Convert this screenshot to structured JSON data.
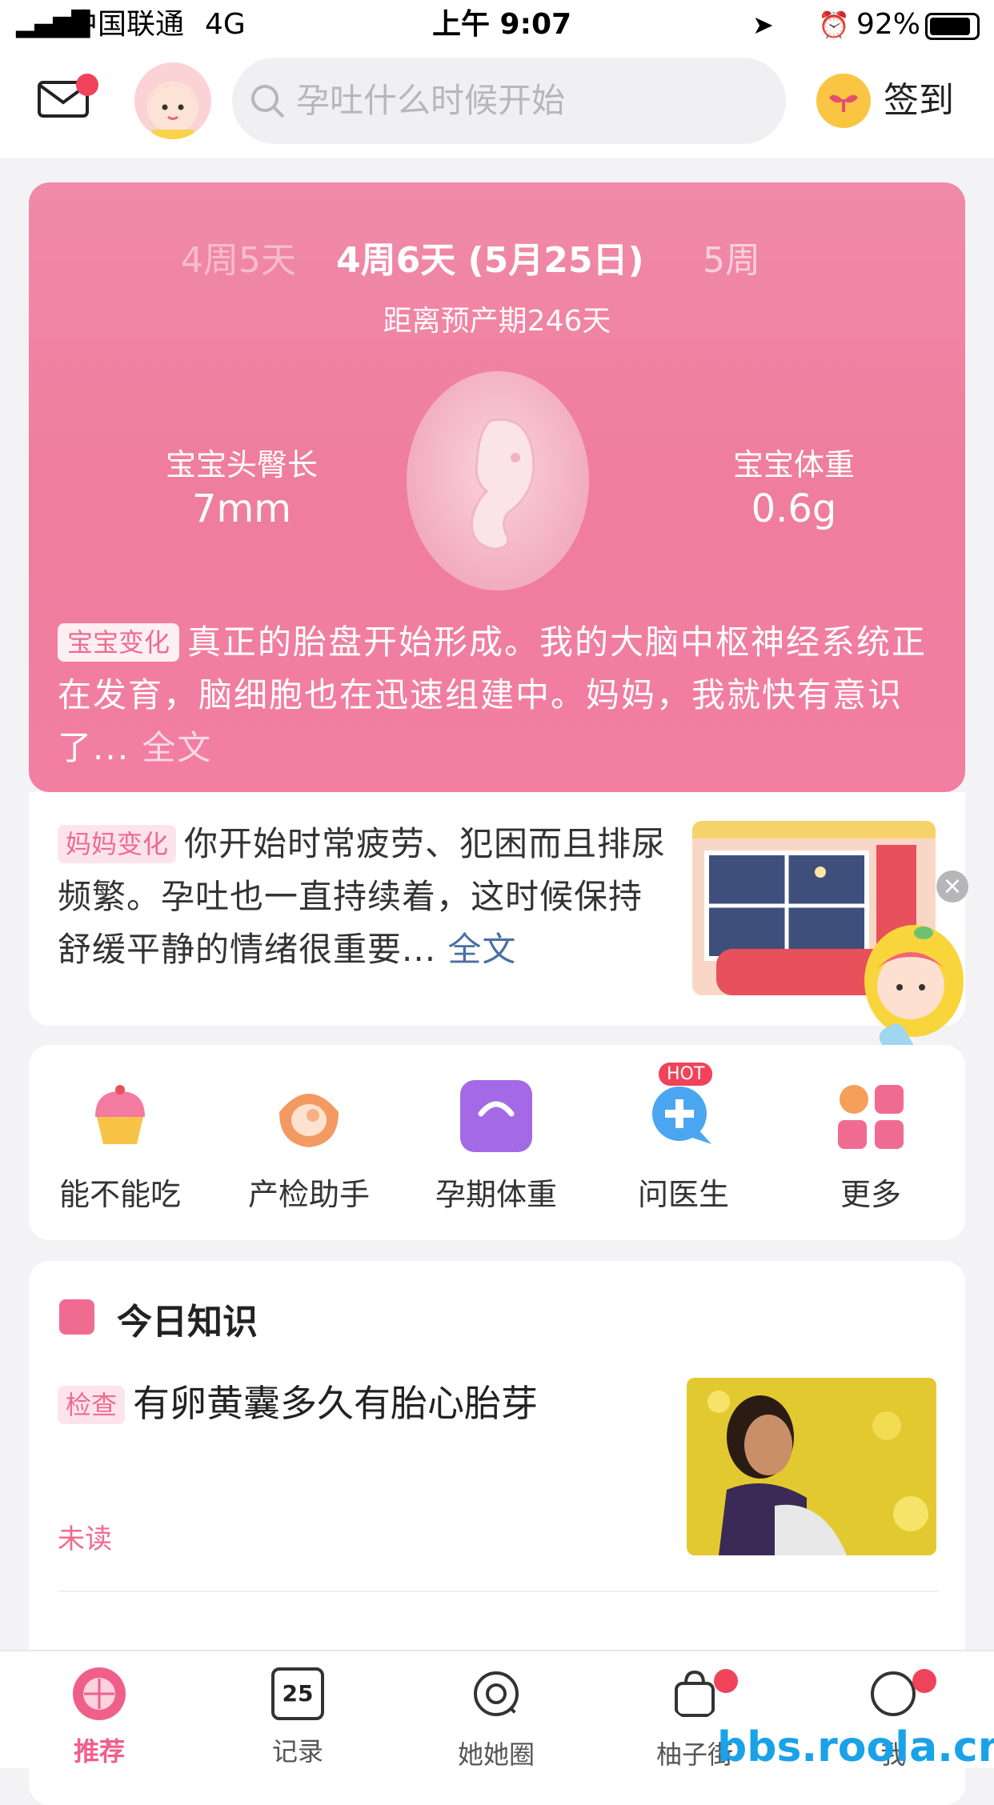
{
  "status": {
    "carrier": "中国联通",
    "network": "4G",
    "time": "上午 9:07",
    "battery": "92%"
  },
  "header": {
    "search_placeholder": "孕吐什么时候开始",
    "sign_in": "签到"
  },
  "pregnancy": {
    "weeks": [
      "4周5天",
      "4周6天 (5月25日)",
      "5周"
    ],
    "countdown": "距离预产期246天",
    "crl_label": "宝宝头臀长",
    "crl_value": "7mm",
    "weight_label": "宝宝体重",
    "weight_value": "0.6g",
    "baby_tag": "宝宝变化",
    "baby_text": "真正的胎盘开始形成。我的大脑中枢神经系统正在发育，脑细胞也在迅速组建中。妈妈，我就快有意识了...",
    "baby_more": "全文"
  },
  "mom": {
    "tag": "妈妈变化",
    "text": "你开始时常疲劳、犯困而且排尿频繁。孕吐也一直持续着，这时候保持舒缓平静的情绪很重要...",
    "more": "全文"
  },
  "tools": [
    {
      "label": "能不能吃",
      "icon": "cupcake-icon"
    },
    {
      "label": "产检助手",
      "icon": "ultrasound-icon"
    },
    {
      "label": "孕期体重",
      "icon": "scale-icon"
    },
    {
      "label": "问医生",
      "icon": "doctor-chat-icon",
      "badge": "HOT"
    },
    {
      "label": "更多",
      "icon": "grid-icon"
    }
  ],
  "knowledge": {
    "title": "今日知识",
    "article_tag": "检查",
    "article_title": "有卵黄囊多久有胎心胎芽",
    "status": "未读"
  },
  "tabbar": [
    {
      "label": "推荐",
      "active": true
    },
    {
      "label": "记录",
      "icon_text": "25"
    },
    {
      "label": "她她圈"
    },
    {
      "label": "柚子街"
    },
    {
      "label": "我"
    }
  ],
  "watermark": "bbs.roola.cn",
  "colors": {
    "brand_pink": "#ef6b90",
    "card_pink": "#f08aa9",
    "link_blue": "#4a6fa5",
    "badge_red": "#f0435a"
  }
}
